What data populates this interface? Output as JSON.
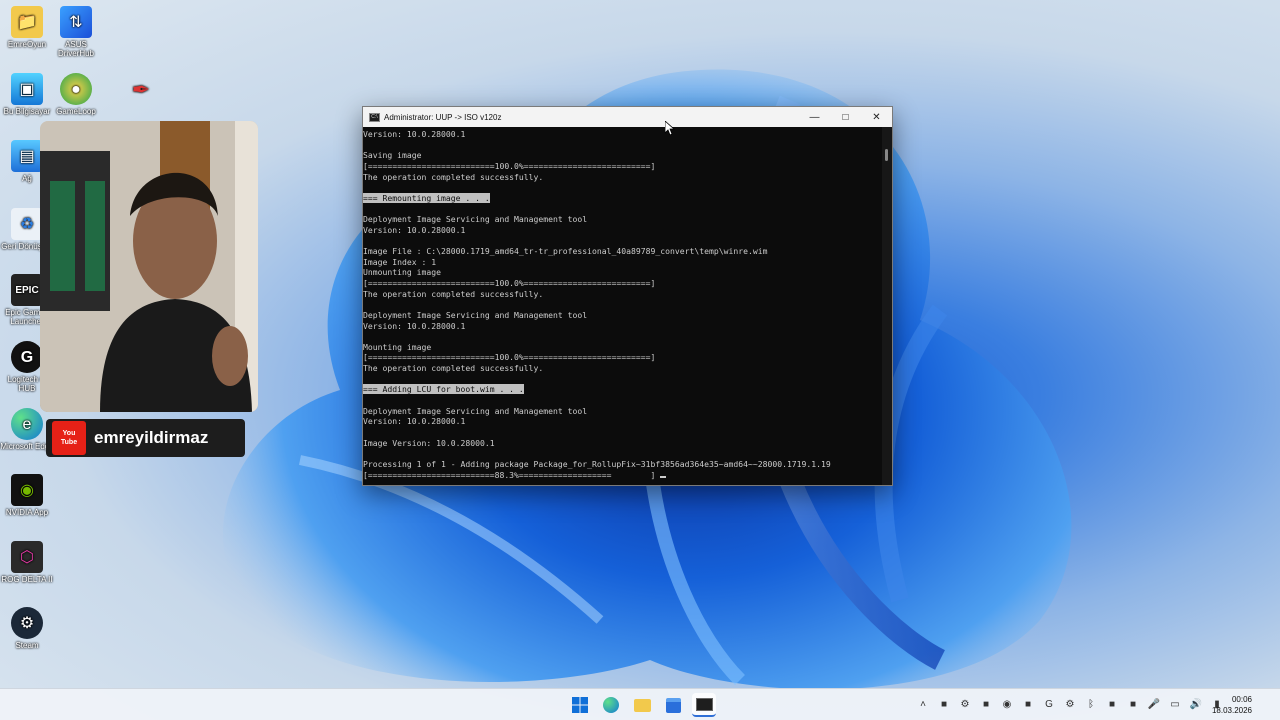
{
  "desktop": {
    "icons": [
      {
        "label": "EmreOyun",
        "icon": "folder-icon"
      },
      {
        "label": "ASUS DriverHub",
        "icon": "asus-driverhub-icon"
      },
      {
        "label": "Bu Bilgisayar",
        "icon": "computer-icon"
      },
      {
        "label": "GameLoop",
        "icon": "gameloop-icon"
      },
      {
        "label": "",
        "icon": "pen-app-icon"
      },
      {
        "label": "Ağ",
        "icon": "network-icon"
      },
      {
        "label": "Geri Dönüşüm",
        "icon": "recycle-bin-icon"
      },
      {
        "label": "Epic Games Launcher",
        "icon": "epic-games-icon"
      },
      {
        "label": "Logitech G HUB",
        "icon": "logitech-ghub-icon"
      },
      {
        "label": "Microsoft Edge",
        "icon": "edge-icon"
      },
      {
        "label": "NVIDIA App",
        "icon": "nvidia-icon"
      },
      {
        "label": "ROG DELTA II",
        "icon": "rog-delta-icon"
      },
      {
        "label": "Steam",
        "icon": "steam-icon"
      }
    ]
  },
  "overlay": {
    "youtube_logo_top": "You",
    "youtube_logo_bottom": "Tube",
    "channel_name": "emreyildirmaz"
  },
  "console": {
    "title": "Administrator:  UUP -> ISO v120z",
    "lines": [
      {
        "text": "Version: 10.0.28000.1",
        "hl": false
      },
      {
        "text": "",
        "hl": false
      },
      {
        "text": "Saving image",
        "hl": false
      },
      {
        "text": "[==========================100.0%==========================]",
        "hl": false
      },
      {
        "text": "The operation completed successfully.",
        "hl": false
      },
      {
        "text": "",
        "hl": false
      },
      {
        "text": "=== Remounting image . . .",
        "hl": true
      },
      {
        "text": "",
        "hl": false
      },
      {
        "text": "Deployment Image Servicing and Management tool",
        "hl": false
      },
      {
        "text": "Version: 10.0.28000.1",
        "hl": false
      },
      {
        "text": "",
        "hl": false
      },
      {
        "text": "Image File : C:\\28000.1719_amd64_tr-tr_professional_40a89789_convert\\temp\\winre.wim",
        "hl": false
      },
      {
        "text": "Image Index : 1",
        "hl": false
      },
      {
        "text": "Unmounting image",
        "hl": false
      },
      {
        "text": "[==========================100.0%==========================]",
        "hl": false
      },
      {
        "text": "The operation completed successfully.",
        "hl": false
      },
      {
        "text": "",
        "hl": false
      },
      {
        "text": "Deployment Image Servicing and Management tool",
        "hl": false
      },
      {
        "text": "Version: 10.0.28000.1",
        "hl": false
      },
      {
        "text": "",
        "hl": false
      },
      {
        "text": "Mounting image",
        "hl": false
      },
      {
        "text": "[==========================100.0%==========================]",
        "hl": false
      },
      {
        "text": "The operation completed successfully.",
        "hl": false
      },
      {
        "text": "",
        "hl": false
      },
      {
        "text": "=== Adding LCU for boot.wim . . .",
        "hl": true
      },
      {
        "text": "",
        "hl": false
      },
      {
        "text": "Deployment Image Servicing and Management tool",
        "hl": false
      },
      {
        "text": "Version: 10.0.28000.1",
        "hl": false
      },
      {
        "text": "",
        "hl": false
      },
      {
        "text": "Image Version: 10.0.28000.1",
        "hl": false
      },
      {
        "text": "",
        "hl": false
      },
      {
        "text": "Processing 1 of 1 - Adding package Package_for_RollupFix~31bf3856ad364e35~amd64~~28000.1719.1.19",
        "hl": false
      },
      {
        "text": "[==========================88.3%===================        ] ",
        "hl": false
      }
    ],
    "progress_percent": 88.3
  },
  "taskbar": {
    "apps": [
      {
        "icon": "windows-start-icon",
        "active": false
      },
      {
        "icon": "edge-icon",
        "active": false
      },
      {
        "icon": "file-explorer-icon",
        "active": false
      },
      {
        "icon": "store-icon",
        "active": false
      },
      {
        "icon": "terminal-icon",
        "active": true
      }
    ],
    "tray_icons": [
      "show-hidden-icon",
      "app-tray-icon-1",
      "steam-tray-icon",
      "app-tray-icon-2",
      "nvidia-tray-icon",
      "app-tray-icon-3",
      "ghub-tray-icon",
      "settings-tray-icon",
      "bluetooth-icon",
      "app-tray-icon-4",
      "app-tray-icon-5",
      "microphone-icon",
      "network-icon",
      "volume-icon",
      "battery-icon"
    ],
    "time": "00:06",
    "date": "18.03.2026"
  }
}
